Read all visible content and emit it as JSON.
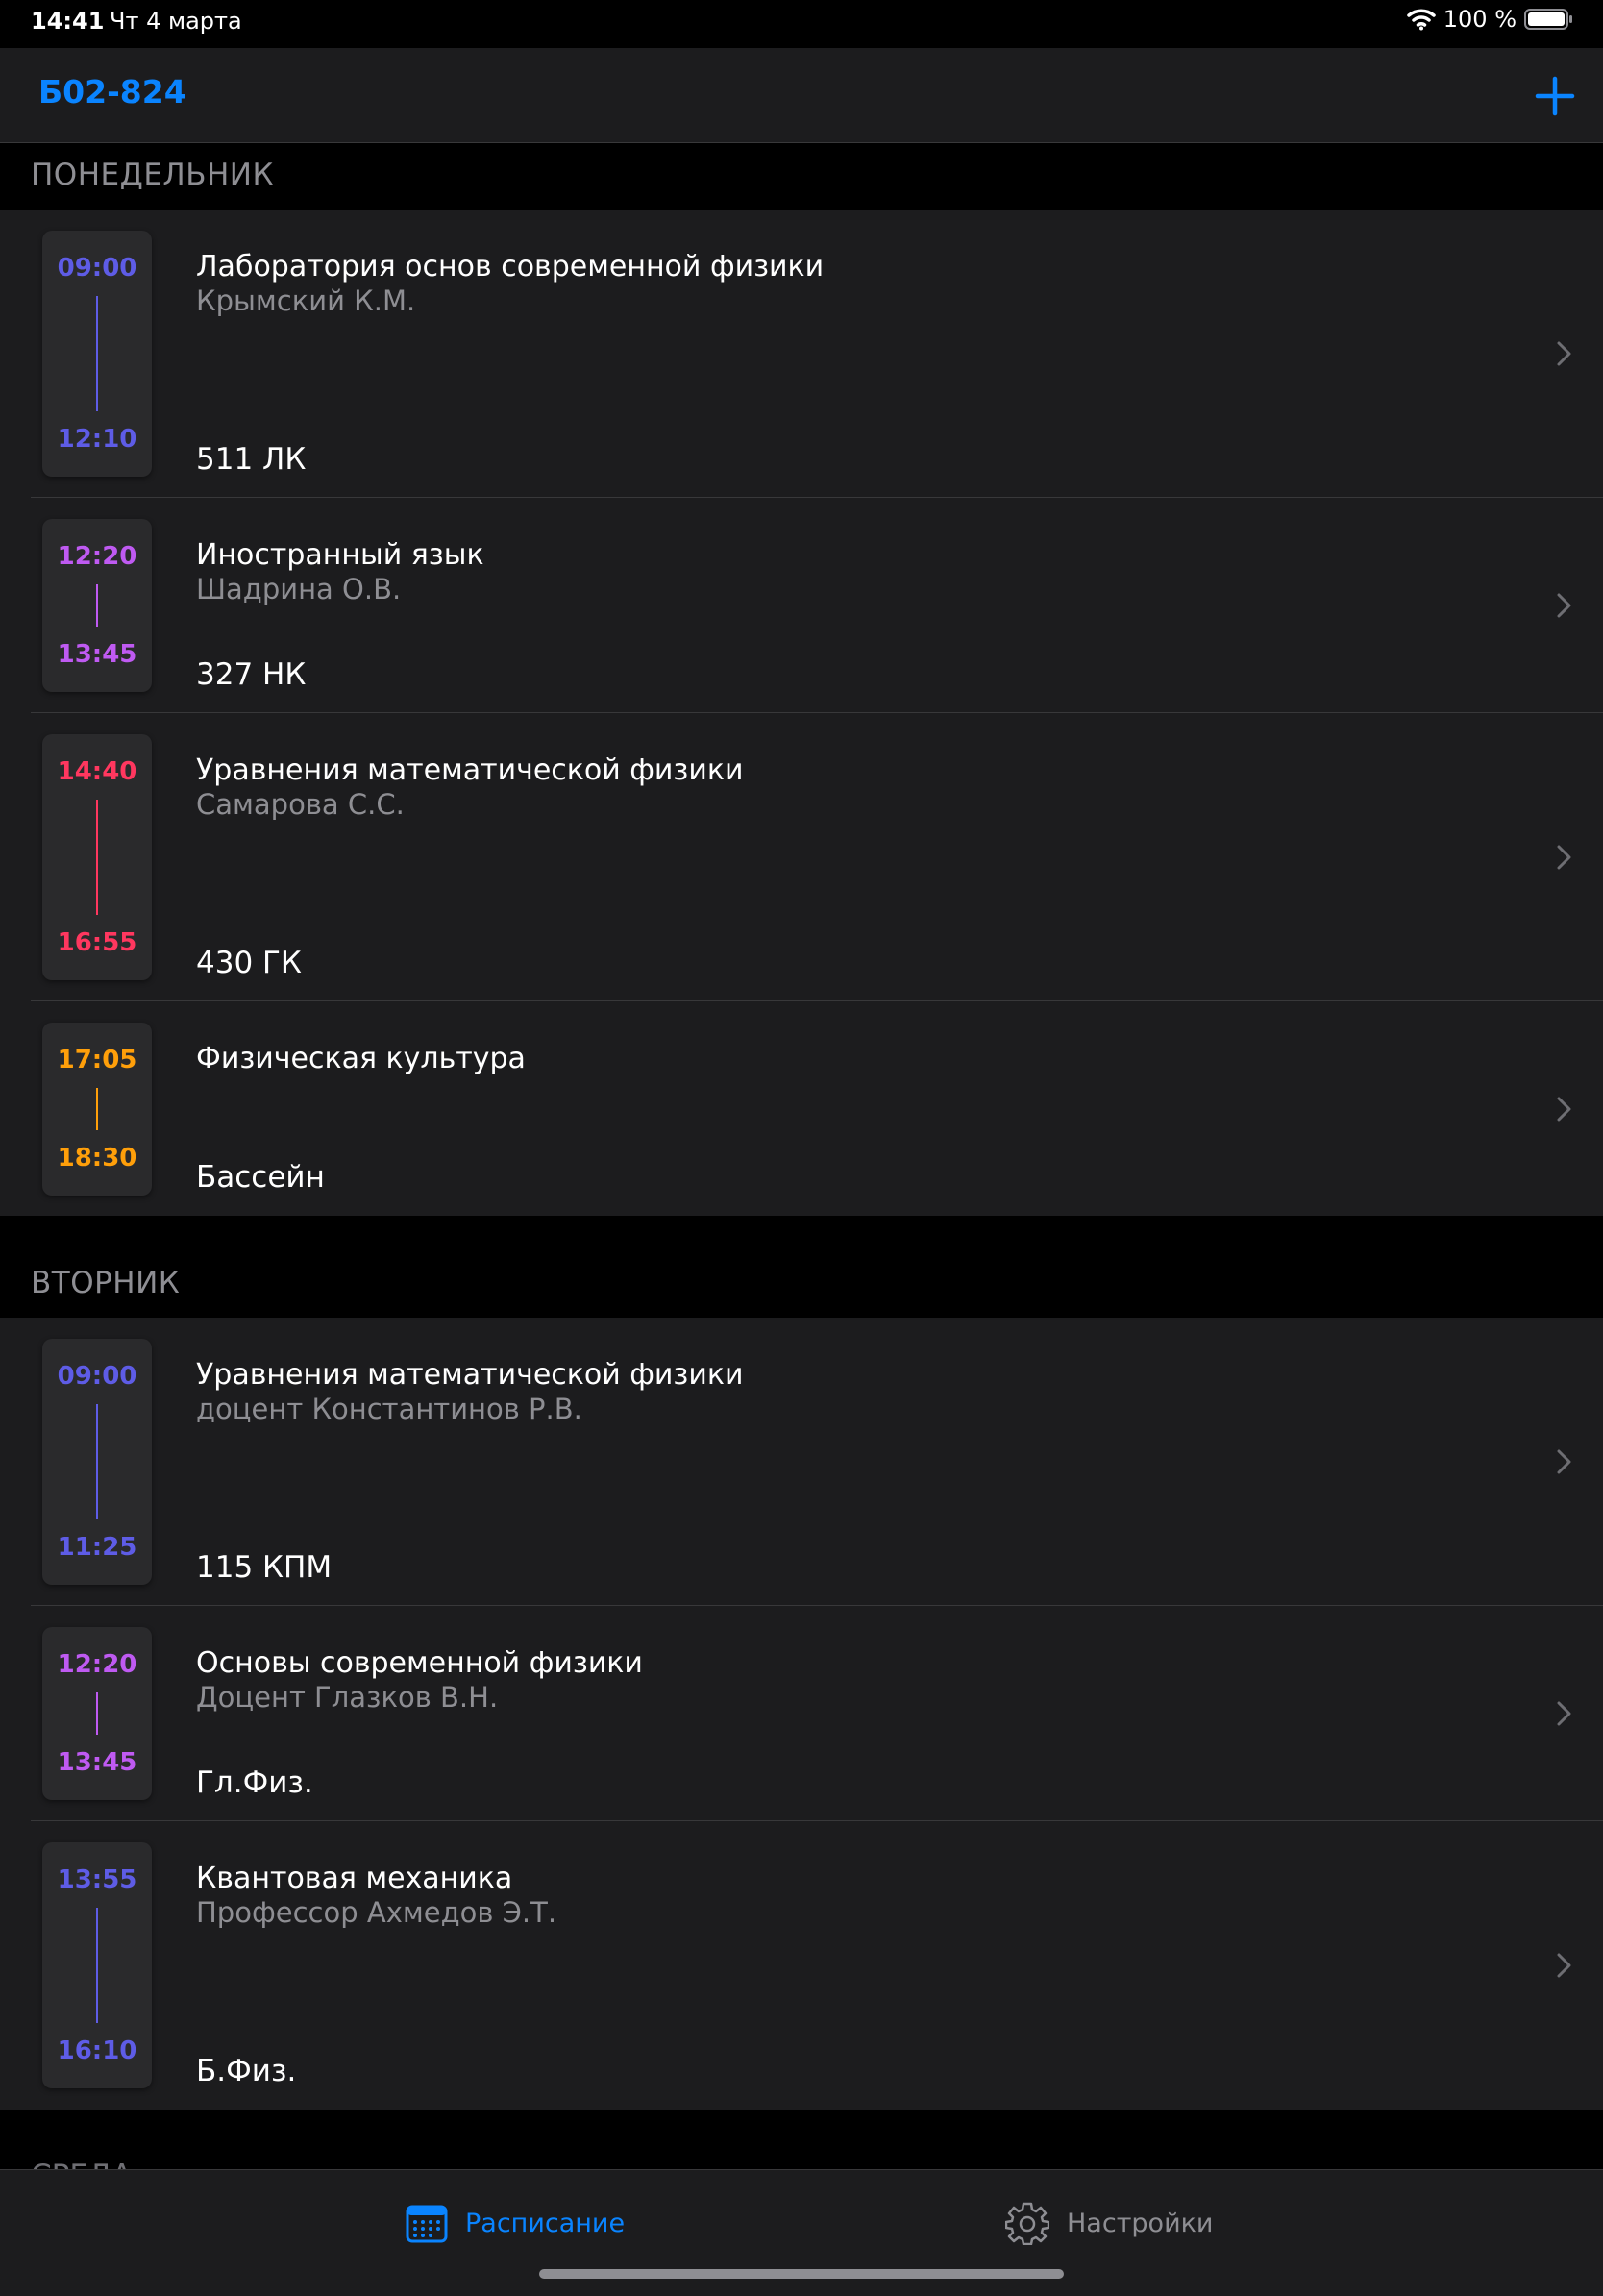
{
  "status": {
    "time": "14:41",
    "date": "Чт 4 марта",
    "battery": "100 %"
  },
  "nav": {
    "title": "Б02-824"
  },
  "colors": {
    "accent": "#0a84ff",
    "indigo": "#5e5ce6",
    "purple": "#bf5af2",
    "red": "#ff375f",
    "orange": "#ff9f0a"
  },
  "days": [
    {
      "name": "ПОНЕДЕЛЬНИК",
      "lessons": [
        {
          "start": "09:00",
          "end": "12:10",
          "subject": "Лаборатория основ современной физики",
          "teacher": "Крымский К.М.",
          "room": "511 ЛК",
          "color": "#5e5ce6"
        },
        {
          "start": "12:20",
          "end": "13:45",
          "subject": "Иностранный язык",
          "teacher": "Шадрина О.В.",
          "room": "327 НК",
          "color": "#bf5af2"
        },
        {
          "start": "14:40",
          "end": "16:55",
          "subject": "Уравнения математической физики",
          "teacher": "Самарова С.С.",
          "room": "430 ГК",
          "color": "#ff375f"
        },
        {
          "start": "17:05",
          "end": "18:30",
          "subject": "Физическая культура",
          "teacher": "",
          "room": "Бассейн",
          "color": "#ff9f0a"
        }
      ]
    },
    {
      "name": "ВТОРНИК",
      "lessons": [
        {
          "start": "09:00",
          "end": "11:25",
          "subject": "Уравнения математической физики",
          "teacher": "доцент Константинов Р.В.",
          "room": "115 КПМ",
          "color": "#5e5ce6"
        },
        {
          "start": "12:20",
          "end": "13:45",
          "subject": "Основы современной физики",
          "teacher": "Доцент Глазков В.Н.",
          "room": "Гл.Физ.",
          "color": "#bf5af2"
        },
        {
          "start": "13:55",
          "end": "16:10",
          "subject": "Квантовая механика",
          "teacher": "Профессор Ахмедов Э.Т.",
          "room": "Б.Физ.",
          "color": "#5e5ce6"
        }
      ]
    }
  ],
  "next_section_peek": "СРЕДА",
  "tabs": [
    {
      "label": "Расписание",
      "icon": "calendar-icon",
      "active": true
    },
    {
      "label": "Настройки",
      "icon": "gear-icon",
      "active": false
    }
  ]
}
